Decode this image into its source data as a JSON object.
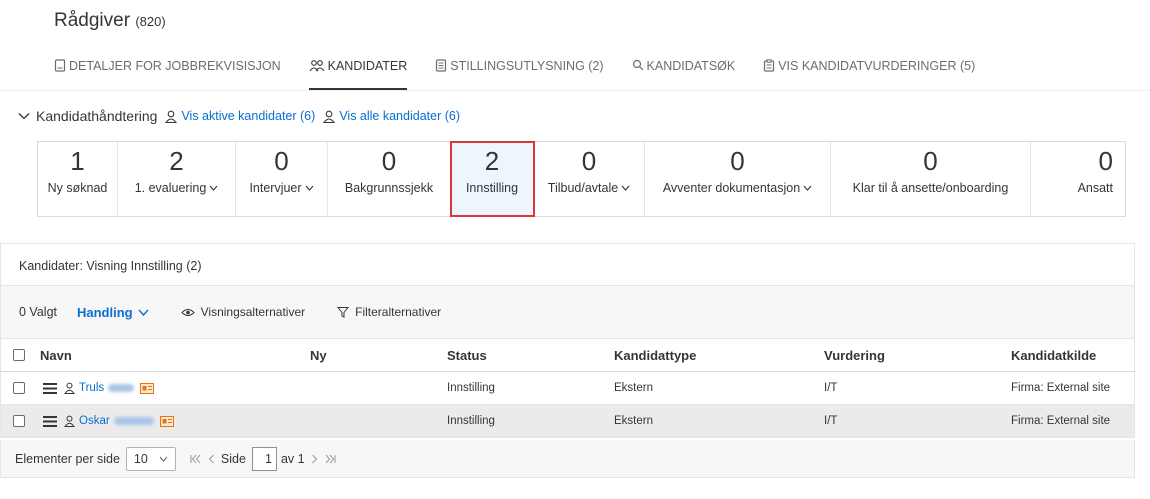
{
  "header": {
    "title": "Rådgiver",
    "count": "(820)",
    "tabs": [
      {
        "label": "DETALJER FOR JOBBREKVISISJON",
        "icon": "document-icon",
        "active": false
      },
      {
        "label": "KANDIDATER",
        "icon": "people-icon",
        "active": true
      },
      {
        "label": "STILLINGSUTLYSNING (2)",
        "icon": "posting-icon",
        "active": false
      },
      {
        "label": "KANDIDATSØK",
        "icon": "search-icon",
        "active": false
      },
      {
        "label": "VIS KANDIDATVURDERINGER (5)",
        "icon": "clipboard-icon",
        "active": false
      }
    ]
  },
  "candidates": {
    "heading": "Kandidathåndtering",
    "link_active": "Vis aktive kandidater (6)",
    "link_all": "Vis alle kandidater (6)",
    "stages": [
      {
        "count": "1",
        "label": "Ny søknad",
        "dropdown": false
      },
      {
        "count": "2",
        "label": "1. evaluering",
        "dropdown": true
      },
      {
        "count": "0",
        "label": "Intervjuer",
        "dropdown": true
      },
      {
        "count": "0",
        "label": "Bakgrunnssjekk",
        "dropdown": false
      },
      {
        "count": "2",
        "label": "Innstilling",
        "dropdown": false,
        "selected": true
      },
      {
        "count": "0",
        "label": "Tilbud/avtale",
        "dropdown": true
      },
      {
        "count": "0",
        "label": "Avventer dokumentasjon",
        "dropdown": true
      },
      {
        "count": "0",
        "label": "Klar til å ansette/onboarding",
        "dropdown": false
      },
      {
        "count": "0",
        "label": "Ansatt",
        "dropdown": false
      }
    ]
  },
  "list": {
    "title": "Kandidater: Visning Innstilling (2)",
    "selected": "0 Valgt",
    "action": "Handling",
    "view_options": "Visningsalternativer",
    "filter_options": "Filteralternativer",
    "columns": [
      "Navn",
      "Ny",
      "Status",
      "Kandidattype",
      "Vurdering",
      "Kandidatkilde"
    ],
    "rows": [
      {
        "name": "Truls",
        "status": "Innstilling",
        "type": "Ekstern",
        "rating": "I/T",
        "source": "Firma: External site"
      },
      {
        "name": "Oskar",
        "status": "Innstilling",
        "type": "Ekstern",
        "rating": "I/T",
        "source": "Firma: External site"
      }
    ]
  },
  "pager": {
    "per_page_label": "Elementer per side",
    "per_page_value": "10",
    "page_label": "Side",
    "page_value": "1",
    "of_label": "av 1"
  },
  "colors": {
    "link": "#0a6ed1",
    "selected_border": "#d9373a",
    "selected_bg": "#eef5fc",
    "badge": "#e9730c"
  }
}
